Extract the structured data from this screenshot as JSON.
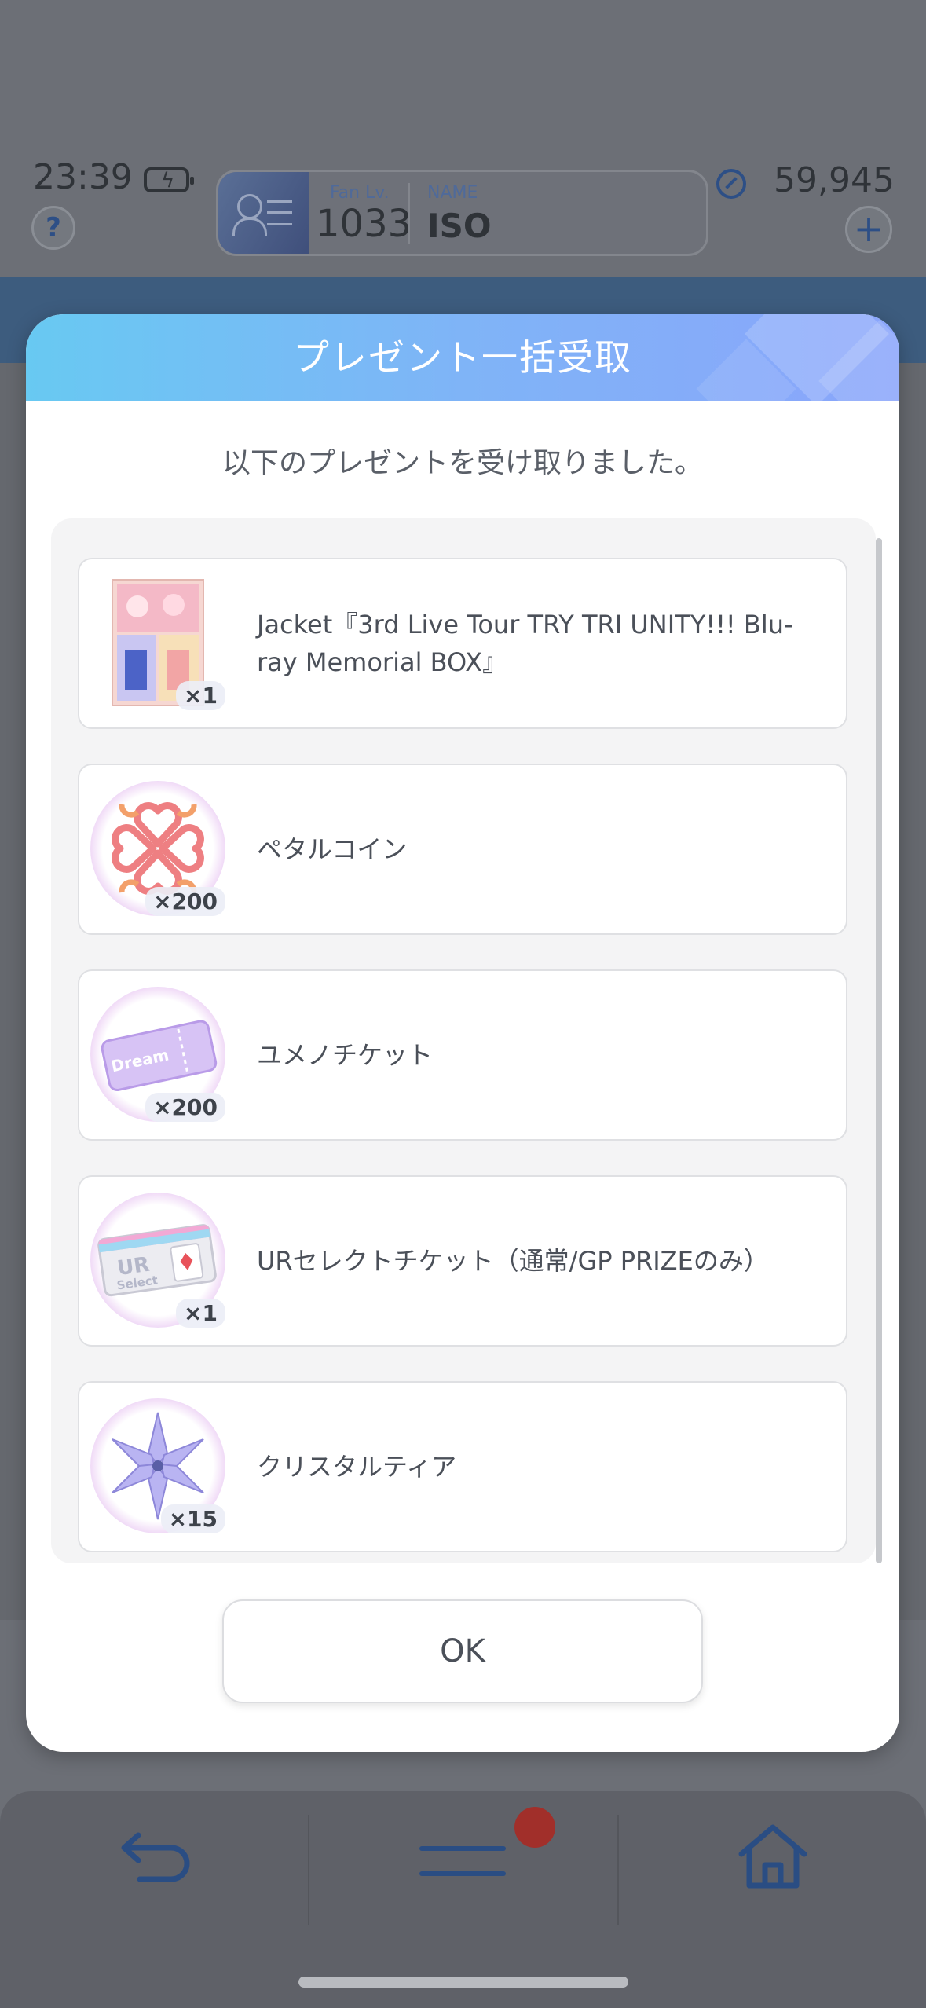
{
  "status": {
    "time": "23:39"
  },
  "profile": {
    "fan_label": "Fan Lv.",
    "fan_value": "1033",
    "name_label": "NAME",
    "name_value": "ISO"
  },
  "currency": {
    "value": "59,945",
    "icon": "currency-icon"
  },
  "help_label": "?",
  "add_label": "+",
  "modal": {
    "title": "プレゼント一括受取",
    "subtitle": "以下のプレゼントを受け取りました。",
    "items": [
      {
        "name": "Jacket『3rd Live Tour TRY TRI UNITY!!! Blu-ray Memorial BOX』",
        "qty": "×1",
        "icon": "jacket-image"
      },
      {
        "name": "ペタルコイン",
        "qty": "×200",
        "icon": "petal-coin-icon"
      },
      {
        "name": "ユメノチケット",
        "qty": "×200",
        "icon": "dream-ticket-icon"
      },
      {
        "name": "URセレクトチケット（通常/GP PRIZEのみ）",
        "qty": "×1",
        "icon": "ur-select-ticket-icon"
      },
      {
        "name": "クリスタルティア",
        "qty": "×15",
        "icon": "crystal-tear-icon"
      }
    ],
    "ok_label": "OK"
  },
  "nav": {
    "back_icon": "back-arrow-icon",
    "menu_icon": "menu-icon",
    "home_icon": "home-icon"
  },
  "colors": {
    "header_gradient_start": "#68c9f2",
    "header_gradient_end": "#8aa5fb",
    "notification": "#a12f2a"
  }
}
